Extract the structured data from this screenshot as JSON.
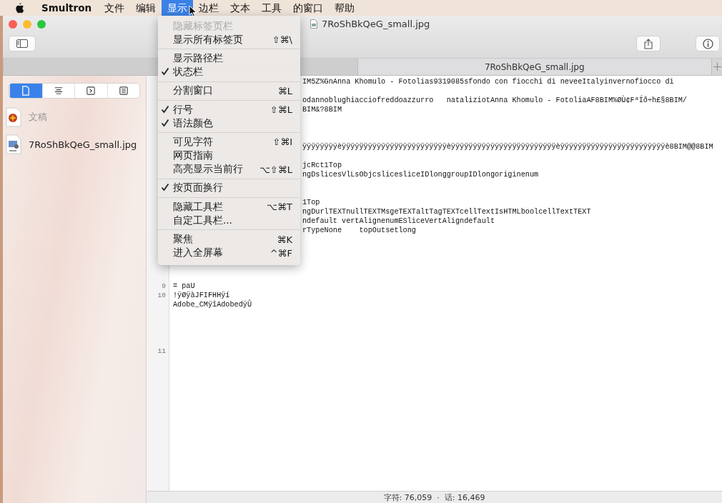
{
  "menubar": {
    "app": "Smultron",
    "menus": [
      {
        "label": "文件",
        "selected": false
      },
      {
        "label": "编辑",
        "selected": false
      },
      {
        "label": "显示",
        "selected": true
      },
      {
        "label": "边栏",
        "selected": false
      },
      {
        "label": "文本",
        "selected": false
      },
      {
        "label": "工具",
        "selected": false
      },
      {
        "label": "的窗口",
        "selected": false
      },
      {
        "label": "帮助",
        "selected": false
      }
    ]
  },
  "window": {
    "title": "7RoShBkQeG_small.jpg"
  },
  "tabs": [
    {
      "selected": false
    },
    {
      "label": "7RoShBkQeG_small.jpg",
      "selected": true
    }
  ],
  "sidebar": {
    "segments": [
      {
        "kind": "document",
        "selected": true
      },
      {
        "kind": "outline",
        "selected": false
      },
      {
        "kind": "console",
        "selected": false
      },
      {
        "kind": "list",
        "selected": false
      }
    ],
    "items": [
      {
        "kind": "group",
        "label": "文稿",
        "disabled": true
      },
      {
        "kind": "file",
        "label": "7RoShBkQeG_small.jpg",
        "disabled": false
      }
    ]
  },
  "editor": {
    "rows": [
      {
        "kind": "partial",
        "text": "IM5Z%GnAnna Khomulo - Fotolias9319085sfondo con fiocchi di neveeItalyinvernofiocco di"
      },
      {
        "kind": "blank"
      },
      {
        "kind": "partial",
        "text": "odannoblughiacciofreddoazzurro   nataliziotAnna Khomulo - FotoliaAF8BIM%ØÙ¢FªÍð÷h£§8BIM/"
      },
      {
        "kind": "partial",
        "text": "BIM&?8BIM"
      },
      {
        "kind": "blank"
      },
      {
        "kind": "blank"
      },
      {
        "kind": "blank"
      },
      {
        "kind": "partial",
        "text": "ÿÿÿÿÿÿÿÿèÿÿÿÿÿÿÿÿÿÿÿÿÿÿÿÿÿÿÿÿÿÿÿÿèÿÿÿÿÿÿÿÿÿÿÿÿÿÿÿÿÿÿÿÿÿÿÿÿèÿÿÿÿÿÿÿÿÿÿÿÿÿÿÿÿÿÿÿÿÿÿÿÿè8BIM@@8BIM"
      },
      {
        "kind": "blank"
      },
      {
        "kind": "partial",
        "text": "jcRct1Top"
      },
      {
        "kind": "partial",
        "text": "ngDslicesVlLsObjcslicesliceIDlonggroupIDlongoriginenum"
      },
      {
        "kind": "blank"
      },
      {
        "kind": "blank"
      },
      {
        "kind": "partial",
        "text": "1Top"
      },
      {
        "kind": "partial",
        "text": "ngDurlTEXTnullTEXTMsgeTEXTaltTagTEXTcellTextIsHTMLboolcellTextTEXT"
      },
      {
        "kind": "partial",
        "text": "ndefault vertAlignenumESliceVertAligndefault"
      },
      {
        "kind": "partial",
        "text": "rTypeNone    topOutsetlong"
      },
      {
        "kind": "blank"
      },
      {
        "kind": "blank"
      },
      {
        "kind": "blank"
      },
      {
        "kind": "blank"
      },
      {
        "kind": "blank"
      },
      {
        "kind": "full",
        "number": "9",
        "text": "= paU"
      },
      {
        "kind": "full",
        "number": "10",
        "text": "!ÿØÿàJFIFHHÿí"
      },
      {
        "kind": "full",
        "text": "Adobe_CMÿîAdobedÿÛ"
      },
      {
        "kind": "blank"
      },
      {
        "kind": "blank"
      },
      {
        "kind": "blank"
      },
      {
        "kind": "blank"
      },
      {
        "kind": "full",
        "number": "11"
      }
    ]
  },
  "status_bar": {
    "text": "字符: 76,059  ·  话: 16,469"
  },
  "menu": {
    "groups": [
      {
        "items": [
          {
            "label": "隐藏标签页栏",
            "disabled": true,
            "checked": false
          },
          {
            "label": "显示所有标签页",
            "shortcut": "⇧⌘\\",
            "disabled": false,
            "checked": false
          }
        ]
      },
      {
        "items": [
          {
            "label": "显示路径栏",
            "disabled": false,
            "checked": false
          },
          {
            "label": "状态栏",
            "disabled": false,
            "checked": true
          }
        ]
      },
      {
        "items": [
          {
            "label": "分割窗口",
            "shortcut": "⌘L",
            "disabled": false,
            "checked": false
          }
        ]
      },
      {
        "items": [
          {
            "label": "行号",
            "shortcut": "⇧⌘L",
            "disabled": false,
            "checked": true
          },
          {
            "label": "语法颜色",
            "disabled": false,
            "checked": true
          }
        ]
      },
      {
        "items": [
          {
            "label": "可见字符",
            "shortcut": "⇧⌘I",
            "disabled": false,
            "checked": false
          },
          {
            "label": "网页指南",
            "disabled": false,
            "checked": false
          },
          {
            "label": "高亮显示当前行",
            "shortcut": "⌥⇧⌘L",
            "disabled": false,
            "checked": false
          }
        ]
      },
      {
        "items": [
          {
            "label": "按页面换行",
            "disabled": false,
            "checked": true
          }
        ]
      },
      {
        "items": [
          {
            "label": "隐藏工具栏",
            "shortcut": "⌥⌘T",
            "disabled": false,
            "checked": false
          },
          {
            "label": "自定工具栏...",
            "disabled": false,
            "checked": false
          }
        ]
      },
      {
        "items": [
          {
            "label": "聚焦",
            "shortcut": "⌘K",
            "disabled": false,
            "checked": false
          },
          {
            "label": "进入全屏幕",
            "shortcut": "^⌘F",
            "disabled": false,
            "checked": false
          }
        ]
      }
    ]
  }
}
